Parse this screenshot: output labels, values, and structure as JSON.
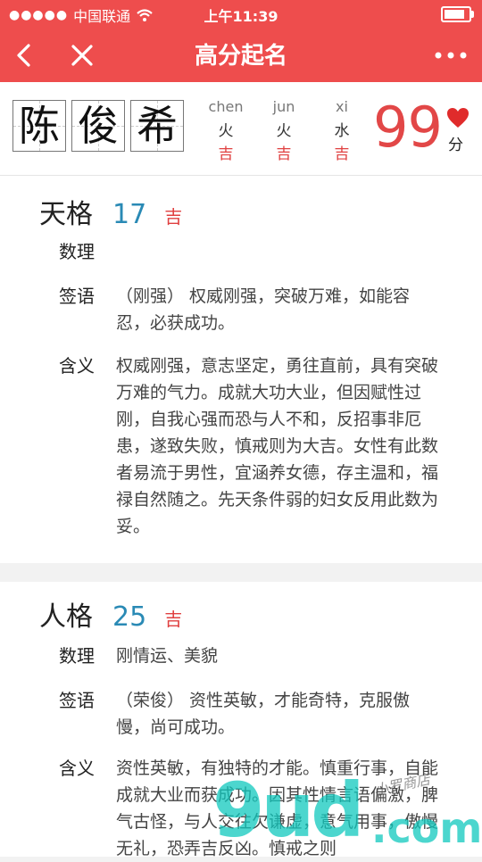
{
  "status": {
    "carrier": "中国联通",
    "time": "上午11:39"
  },
  "nav": {
    "title": "高分起名"
  },
  "name": {
    "chars": [
      "陈",
      "俊",
      "希"
    ],
    "pinyin": [
      {
        "py": "chen",
        "element": "火",
        "fortune": "吉"
      },
      {
        "py": "jun",
        "element": "火",
        "fortune": "吉"
      },
      {
        "py": "xi",
        "element": "水",
        "fortune": "吉"
      }
    ],
    "score": "99",
    "score_unit": "分"
  },
  "sections": [
    {
      "title": "天格",
      "number": "17",
      "luck": "吉",
      "rows": [
        {
          "label": "数理",
          "value": ""
        },
        {
          "label": "签语",
          "value": "（刚强） 权威刚强，突破万难，如能容忍，必获成功。"
        },
        {
          "label": "含义",
          "value": "权威刚强，意志坚定，勇往直前，具有突破万难的气力。成就大功大业，但因赋性过刚，自我心强而恐与人不和，反招事非厄患，遂致失败，慎戒则为大吉。女性有此数者易流于男性，宜涵养女德，存主温和，福禄自然随之。先天条件弱的妇女反用此数为妥。"
        }
      ]
    },
    {
      "title": "人格",
      "number": "25",
      "luck": "吉",
      "rows": [
        {
          "label": "数理",
          "value": "刚情运、美貌"
        },
        {
          "label": "签语",
          "value": "（荣俊） 资性英敏，才能奇特，克服傲慢，尚可成功。"
        },
        {
          "label": "含义",
          "value": "资性英敏，有独特的才能。慎重行事，自能成就大业而获成功。因其性情言语偏激，脾气古怪，与人交往欠谦虚，意气用事，傲慢无礼，恐弄吉反凶。慎戒之则"
        }
      ]
    }
  ],
  "watermark": {
    "brand": "9ud",
    "suffix": ".com",
    "sign": "小罗商店"
  },
  "colors": {
    "accent": "#ee4d4d",
    "number": "#2a8ab5",
    "fortune": "#e04040"
  }
}
